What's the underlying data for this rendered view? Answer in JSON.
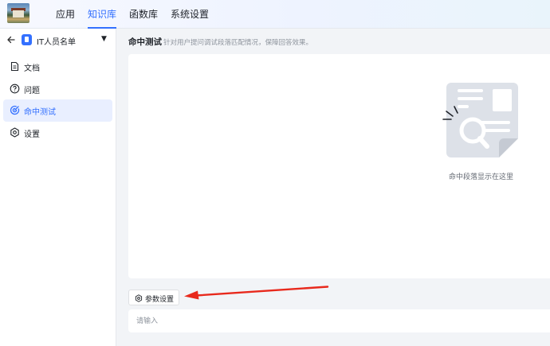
{
  "nav": {
    "items": [
      {
        "label": "应用",
        "active": false
      },
      {
        "label": "知识库",
        "active": true
      },
      {
        "label": "函数库",
        "active": false
      },
      {
        "label": "系统设置",
        "active": false
      }
    ]
  },
  "sidebar": {
    "knowledge_base_name": "IT人员名单",
    "items": [
      {
        "label": "文档",
        "icon": "document-icon",
        "active": false
      },
      {
        "label": "问题",
        "icon": "question-circle-icon",
        "active": false
      },
      {
        "label": "命中测试",
        "icon": "target-icon",
        "active": true
      },
      {
        "label": "设置",
        "icon": "gear-icon",
        "active": false
      }
    ]
  },
  "main": {
    "title": "命中测试",
    "description": "针对用户提问调试段落匹配情况，保障回答效果。",
    "empty_text": "命中段落显示在这里",
    "param_button_label": "参数设置",
    "input_placeholder": "请输入"
  },
  "colors": {
    "accent": "#3370ff",
    "annotation_arrow": "#e8291c"
  }
}
